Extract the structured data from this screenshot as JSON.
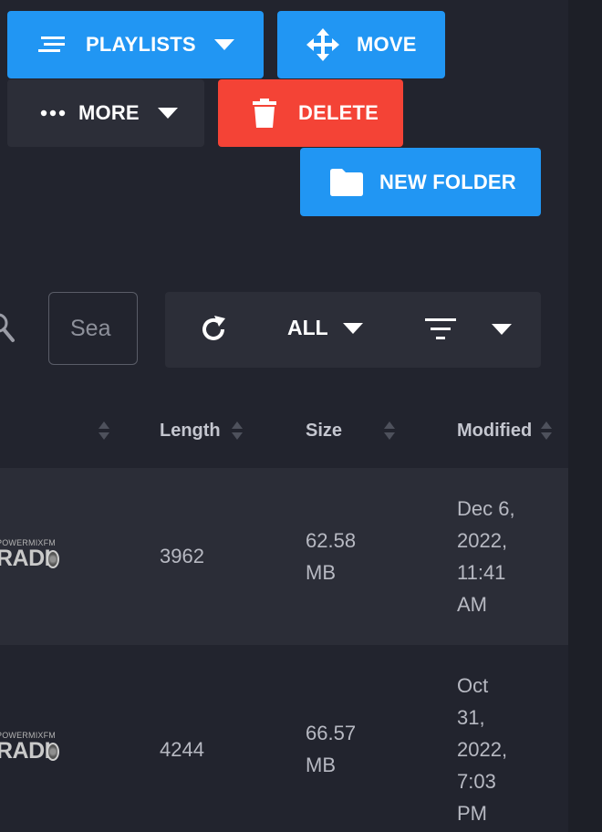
{
  "colors": {
    "primary": "#2196f3",
    "danger": "#f44336",
    "surface": "#2c2e38",
    "background": "#22242e"
  },
  "actions": {
    "playlists": {
      "label": "PLAYLISTS",
      "icon": "playlist-icon"
    },
    "move": {
      "label": "MOVE",
      "icon": "move-arrows-icon"
    },
    "more": {
      "label": "MORE",
      "icon": "ellipsis-icon"
    },
    "delete": {
      "label": "DELETE",
      "icon": "trash-icon"
    },
    "new_folder": {
      "label": "NEW FOLDER",
      "icon": "folder-icon"
    }
  },
  "search": {
    "value": "Sea"
  },
  "toolbar": {
    "refresh_icon": "refresh-icon",
    "filter_value": "ALL",
    "sort_icon": "sort-lines-icon"
  },
  "table": {
    "columns": [
      "Length",
      "Size",
      "Modified"
    ],
    "rows": [
      {
        "logo_text_top": "POWERMIXFM",
        "logo_text": "RADI",
        "length": "3962",
        "size": [
          "62.58",
          "MB"
        ],
        "modified": [
          "Dec 6,",
          "2022,",
          "11:41",
          "AM"
        ]
      },
      {
        "logo_text_top": "POWERMIXFM",
        "logo_text": "RADI",
        "length": "4244",
        "size": [
          "66.57",
          "MB"
        ],
        "modified": [
          "Oct",
          "31,",
          "2022,",
          "7:03",
          "PM"
        ]
      }
    ]
  }
}
